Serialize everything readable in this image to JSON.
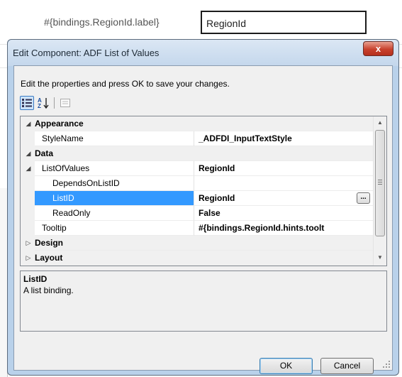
{
  "background": {
    "label_text": "#{bindings.RegionId.label}",
    "field_value": "RegionId"
  },
  "dialog": {
    "title": "Edit Component: ADF List of Values",
    "close_glyph": "x",
    "instruction": "Edit the properties and press OK to save your changes.",
    "toolbar": {
      "categorized_icon": "categorized-icon",
      "alphabetical_icon": "sort-az-icon",
      "property_pages_icon": "property-pages-icon"
    },
    "properties": {
      "appearance": {
        "label": "Appearance"
      },
      "stylename": {
        "name": "StyleName",
        "value": "_ADFDI_InputTextStyle"
      },
      "data": {
        "label": "Data"
      },
      "listofvalues": {
        "name": "ListOfValues",
        "value": "RegionId"
      },
      "dependsonlistid": {
        "name": "DependsOnListID",
        "value": ""
      },
      "listid": {
        "name": "ListID",
        "value": "RegionId",
        "button": "..."
      },
      "readonly": {
        "name": "ReadOnly",
        "value": "False"
      },
      "tooltip": {
        "name": "Tooltip",
        "value": "#{bindings.RegionId.hints.toolt"
      },
      "design": {
        "label": "Design"
      },
      "layout": {
        "label": "Layout"
      }
    },
    "help": {
      "title": "ListID",
      "text": "A list binding."
    },
    "buttons": {
      "ok": "OK",
      "cancel": "Cancel"
    }
  },
  "colors": {
    "selection": "#3399ff",
    "window_frame": "#b9d1ea",
    "close_button": "#c8412d"
  }
}
